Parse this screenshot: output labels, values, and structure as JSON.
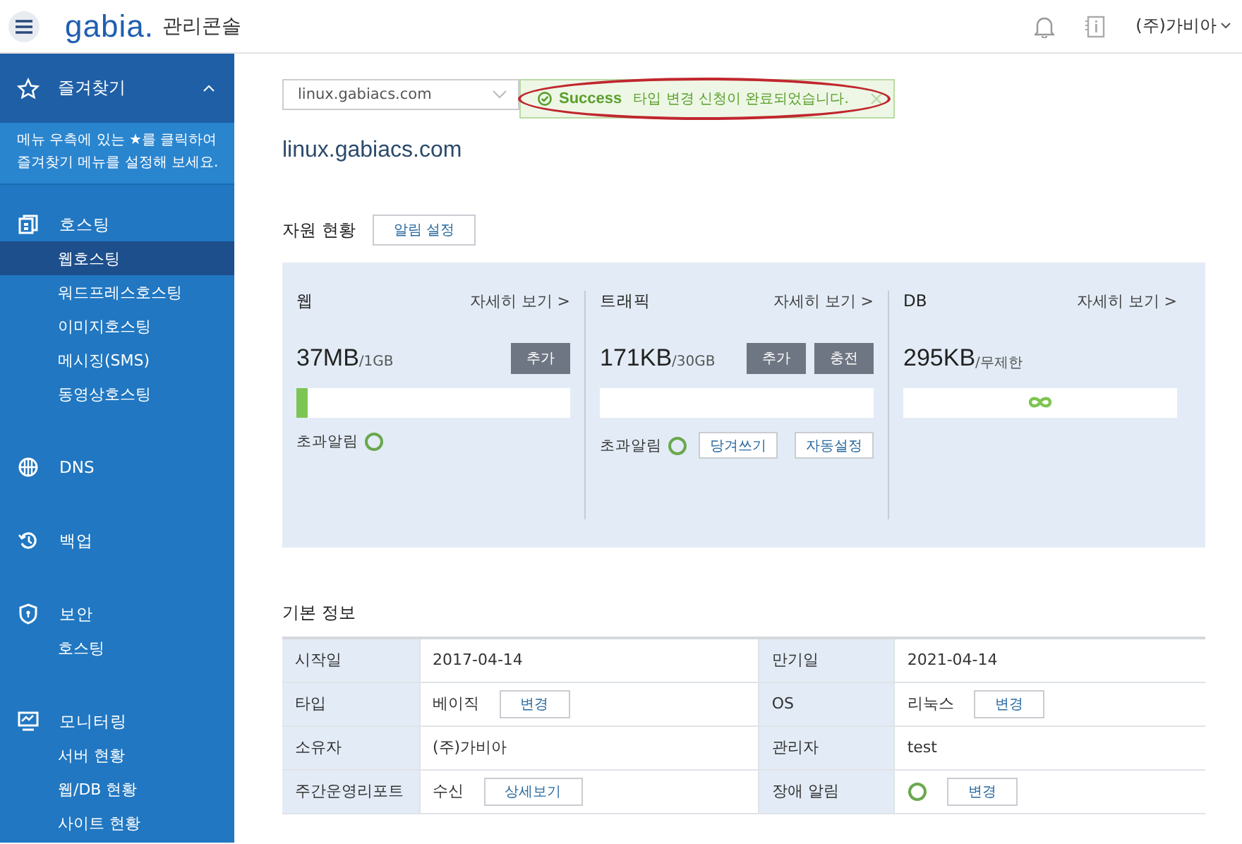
{
  "header": {
    "logo": "gabia.",
    "title": "관리콘솔",
    "user": "(주)가비아"
  },
  "sidebar": {
    "favorites": {
      "label": "즐겨찾기",
      "expanded": true,
      "hint": "메뉴 우측에 있는 ★를 클릭하여 즐겨찾기 메뉴를 설정해 보세요."
    },
    "groups": [
      {
        "label": "호스팅",
        "children": [
          {
            "label": "웹호스팅",
            "selected": true
          },
          {
            "label": "워드프레스호스팅",
            "selected": false
          },
          {
            "label": "이미지호스팅",
            "selected": false
          },
          {
            "label": "메시징(SMS)",
            "selected": false
          },
          {
            "label": "동영상호스팅",
            "selected": false
          }
        ]
      },
      {
        "label": "DNS"
      },
      {
        "label": "백업"
      },
      {
        "label": "보안",
        "children": [
          {
            "label": "호스팅",
            "selected": false
          }
        ]
      },
      {
        "label": "모니터링",
        "children": [
          {
            "label": "서버 현황",
            "selected": false
          },
          {
            "label": "웹/DB 현황",
            "selected": false
          },
          {
            "label": "사이트 현황",
            "selected": false
          }
        ]
      }
    ]
  },
  "main": {
    "domain_select": {
      "value": "linux.gabiacs.com"
    },
    "toast": {
      "status": "Success",
      "message": "타입 변경 신청이 완료되었습니다.",
      "highlighted": true
    },
    "title": "linux.gabiacs.com",
    "resources": {
      "heading": "자원 현황",
      "button": "알림 설정",
      "cards": [
        {
          "kind": "bar",
          "title": "웹",
          "link": "자세히 보기 >",
          "value": "37MB",
          "limit": "/1GB",
          "buttons": [
            "추가"
          ],
          "level": 0.04,
          "alert": "초과알림"
        },
        {
          "kind": "bar",
          "title": "트래픽",
          "link": "자세히 보기 >",
          "value": "171KB",
          "limit": "/30GB",
          "buttons": [
            "추가",
            "충전"
          ],
          "alert": "초과알림",
          "actions": [
            "당겨쓰기",
            "자동설정"
          ]
        },
        {
          "kind": "unlimited",
          "title": "DB",
          "link": "자세히 보기 >",
          "value": "295KB",
          "limit": "/무제한"
        }
      ]
    },
    "info": {
      "heading": "기본 정보",
      "rows": [
        [
          {
            "label": "시작일",
            "kind": "text",
            "value": "2017-04-14"
          },
          {
            "label": "만기일",
            "kind": "text",
            "value": "2021-04-14"
          }
        ],
        [
          {
            "label": "타입",
            "kind": "text",
            "value": "베이직",
            "action": "변경"
          },
          {
            "label": "OS",
            "kind": "text",
            "value": "리눅스",
            "action": "변경"
          }
        ],
        [
          {
            "label": "소유자",
            "kind": "text",
            "value": "(주)가비아"
          },
          {
            "label": "관리자",
            "kind": "text",
            "value": "test"
          }
        ],
        [
          {
            "label": "주간운영리포트",
            "kind": "text",
            "value": "수신",
            "action": "상세보기"
          },
          {
            "label": "장애 알림",
            "kind": "ring",
            "action": "변경"
          }
        ]
      ]
    }
  }
}
